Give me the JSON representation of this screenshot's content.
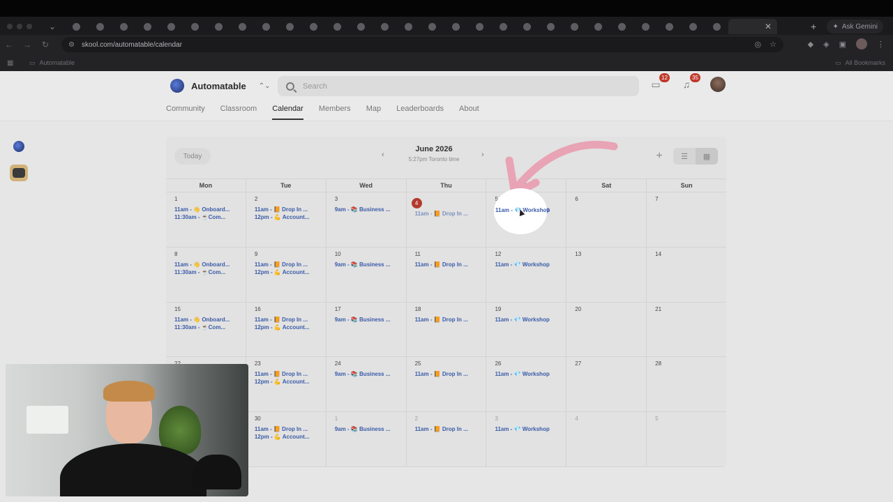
{
  "browser": {
    "url": "skool.com/automatable/calendar",
    "gemini_label": "Ask Gemini",
    "bookmark_folder": "Automatable",
    "all_bookmarks": "All Bookmarks"
  },
  "site": {
    "brand_name": "Automatable",
    "search_placeholder": "Search",
    "chat_badge": "12",
    "notif_badge": "35",
    "nav": [
      "Community",
      "Classroom",
      "Calendar",
      "Members",
      "Map",
      "Leaderboards",
      "About"
    ],
    "active_nav": "Calendar"
  },
  "calendar": {
    "today_label": "Today",
    "month_title": "June 2026",
    "time_sub": "5:27pm Toronto time",
    "days_of_week": [
      "Mon",
      "Tue",
      "Wed",
      "Thu",
      "Fri",
      "Sat",
      "Sun"
    ],
    "weeks": [
      [
        {
          "n": "1",
          "ev": [
            "11am - 👋 Onboard...",
            "11:30am - ☕Com..."
          ]
        },
        {
          "n": "2",
          "ev": [
            "11am - 📙 Drop In ...",
            "12pm - 💪 Account..."
          ]
        },
        {
          "n": "3",
          "ev": [
            "9am - 📚 Business ..."
          ]
        },
        {
          "n": "4",
          "today": true,
          "dim": true,
          "ev": [
            "11am - 📙 Drop In ..."
          ]
        },
        {
          "n": "5",
          "ev": [
            "11am - 💎 Workshop"
          ]
        },
        {
          "n": "6",
          "ev": []
        },
        {
          "n": "7",
          "ev": []
        }
      ],
      [
        {
          "n": "8",
          "ev": [
            "11am - 👋 Onboard...",
            "11:30am - ☕Com..."
          ]
        },
        {
          "n": "9",
          "ev": [
            "11am - 📙 Drop In ...",
            "12pm - 💪 Account..."
          ]
        },
        {
          "n": "10",
          "ev": [
            "9am - 📚 Business ..."
          ]
        },
        {
          "n": "11",
          "ev": [
            "11am - 📙 Drop In ..."
          ]
        },
        {
          "n": "12",
          "ev": [
            "11am - 💎 Workshop"
          ]
        },
        {
          "n": "13",
          "ev": []
        },
        {
          "n": "14",
          "ev": []
        }
      ],
      [
        {
          "n": "15",
          "ev": [
            "11am - 👋 Onboard...",
            "11:30am - ☕Com..."
          ]
        },
        {
          "n": "16",
          "ev": [
            "11am - 📙 Drop In ...",
            "12pm - 💪 Account..."
          ]
        },
        {
          "n": "17",
          "ev": [
            "9am - 📚 Business ..."
          ]
        },
        {
          "n": "18",
          "ev": [
            "11am - 📙 Drop In ..."
          ]
        },
        {
          "n": "19",
          "ev": [
            "11am - 💎 Workshop"
          ]
        },
        {
          "n": "20",
          "ev": []
        },
        {
          "n": "21",
          "ev": []
        }
      ],
      [
        {
          "n": "22",
          "ev": []
        },
        {
          "n": "23",
          "ev": [
            "11am - 📙 Drop In ...",
            "12pm - 💪 Account..."
          ]
        },
        {
          "n": "24",
          "ev": [
            "9am - 📚 Business ..."
          ]
        },
        {
          "n": "25",
          "ev": [
            "11am - 📙 Drop In ..."
          ]
        },
        {
          "n": "26",
          "ev": [
            "11am - 💎 Workshop"
          ]
        },
        {
          "n": "27",
          "ev": []
        },
        {
          "n": "28",
          "ev": []
        }
      ],
      [
        {
          "n": "29",
          "ev": []
        },
        {
          "n": "30",
          "ev": [
            "11am - 📙 Drop In ...",
            "12pm - 💪 Account..."
          ]
        },
        {
          "n": "1",
          "muted": true,
          "ev": [
            "9am - 📚 Business ..."
          ]
        },
        {
          "n": "2",
          "muted": true,
          "ev": [
            "11am - 📙 Drop In ..."
          ]
        },
        {
          "n": "3",
          "muted": true,
          "ev": [
            "11am - 💎 Workshop"
          ]
        },
        {
          "n": "4",
          "muted": true,
          "ev": []
        },
        {
          "n": "5",
          "muted": true,
          "ev": []
        }
      ]
    ],
    "highlight_event": "11am - 💎 Workshop"
  },
  "colors": {
    "event_text": "#3a5ba8",
    "today_badge": "#b33a2e",
    "arrow": "#e8a3b4"
  }
}
